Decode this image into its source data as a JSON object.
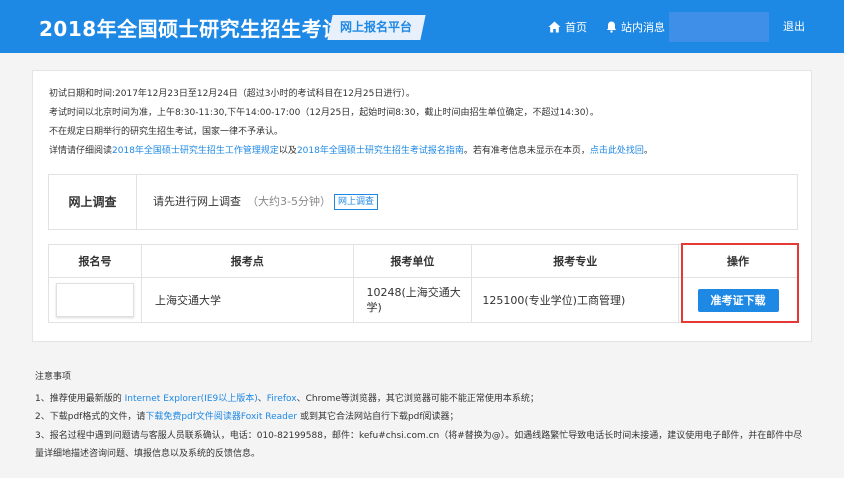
{
  "header": {
    "title": "2018年全国硕士研究生招生考试",
    "platform": "网上报名平台",
    "nav_home": "首页",
    "nav_messages": "站内消息",
    "logout": "退出",
    "accent_color": "#1e88e5"
  },
  "notice": {
    "line1": "初试日期和时间:2017年12月23日至12月24日（超过3小时的考试科目在12月25日进行）。",
    "line2": "考试时间以北京时间为准，上午8:30-11:30,下午14:00-17:00（12月25日，起始时间8:30，截止时间由招生单位确定，不超过14:30）。",
    "line3": "不在规定日期举行的研究生招生考试，国家一律不予承认。",
    "line4_a": "详情请仔细阅读",
    "line4_link1": "2018年全国硕士研究生招生工作管理规定",
    "line4_b": "以及",
    "line4_link2": "2018年全国硕士研究生招生考试报名指南",
    "line4_c": "。若有准考信息未显示在本页，",
    "line4_link3": "点击此处找回",
    "line4_d": "。"
  },
  "survey": {
    "label": "网上调查",
    "text": "请先进行网上调查",
    "hint": "（大约3-5分钟）",
    "button": "网上调查"
  },
  "table": {
    "headers": [
      "报名号",
      "报考点",
      "报考单位",
      "报考专业",
      "操作"
    ],
    "row": {
      "site": "上海交通大学",
      "unit": "10248(上海交通大学)",
      "major": "125100(专业学位)工商管理)",
      "action": "准考证下载"
    }
  },
  "notes": {
    "title": "注意事项",
    "n1_a": "1、推荐使用最新版的 ",
    "n1_link1": "Internet Explorer(IE9以上版本)",
    "n1_b": "、",
    "n1_link2": "Firefox",
    "n1_c": "、Chrome等浏览器，其它浏览器可能不能正常使用本系统；",
    "n2_a": "2、下载pdf格式的文件，请",
    "n2_link": "下载免费pdf文件阅读器Foxit Reader",
    "n2_b": " 或到其它合法网站自行下载pdf阅读器；",
    "n3_line1": "3、报名过程中遇到问题请与客服人员联系确认，电话：010-82199588，邮件：kefu#chsi.com.cn（将#替换为@）。如遇线路繁忙导致电话长时间未接通，建议使用电子邮件，并在邮件中尽",
    "n3_line2": "量详细地描述咨询问题、填报信息以及系统的反馈信息。"
  }
}
